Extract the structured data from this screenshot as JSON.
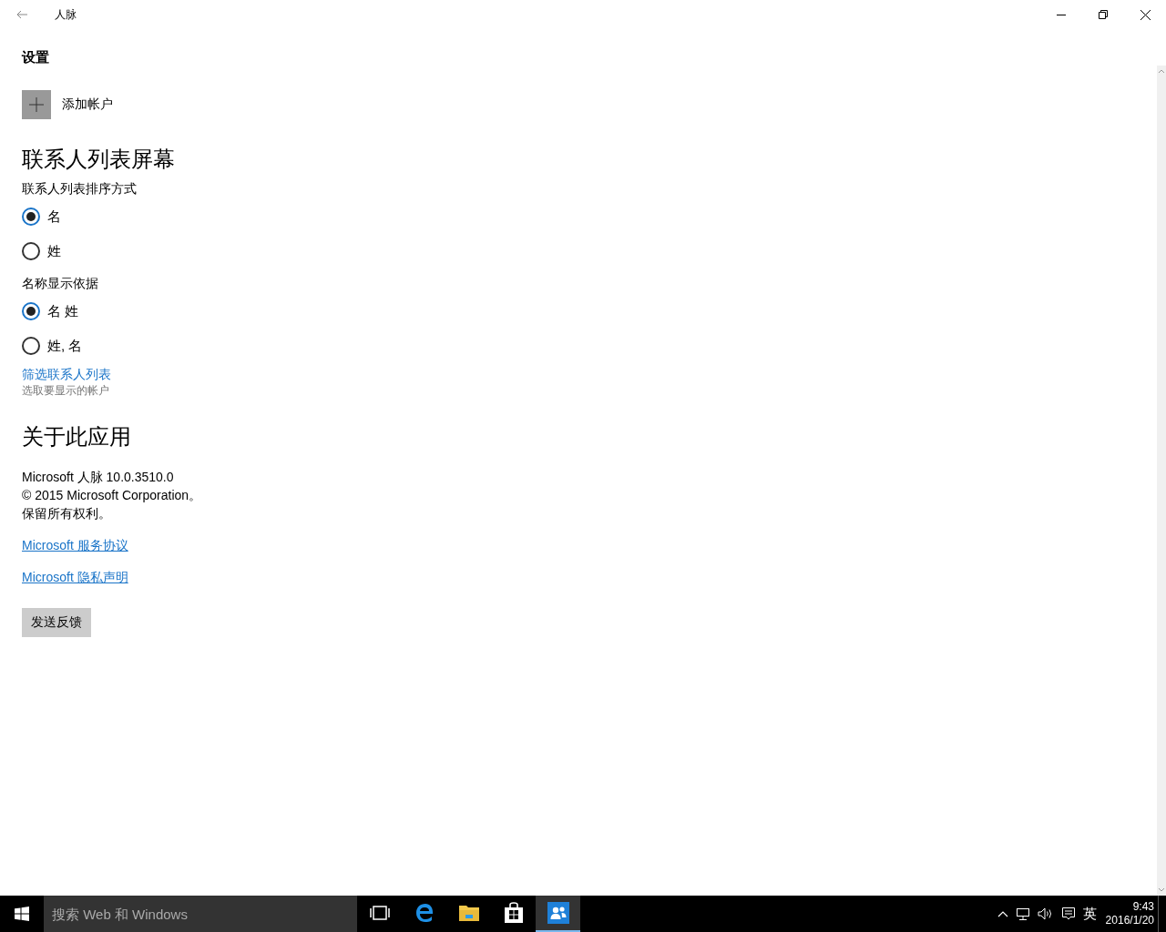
{
  "window": {
    "title": "人脉"
  },
  "page": {
    "heading": "设置"
  },
  "add_account": {
    "label": "添加帐户"
  },
  "contact_list_section": {
    "title": "联系人列表屏幕",
    "groups": [
      {
        "label": "联系人列表排序方式",
        "options": [
          {
            "label": "名",
            "selected": true
          },
          {
            "label": "姓",
            "selected": false
          }
        ]
      },
      {
        "label": "名称显示依据",
        "options": [
          {
            "label": "名 姓",
            "selected": true
          },
          {
            "label": "姓, 名",
            "selected": false
          }
        ]
      }
    ],
    "filter_link": {
      "label": "筛选联系人列表",
      "description": "选取要显示的帐户"
    }
  },
  "about": {
    "title": "关于此应用",
    "lines": [
      "Microsoft 人脉 10.0.3510.0",
      "© 2015 Microsoft Corporation。",
      "保留所有权利。"
    ],
    "links": [
      "Microsoft 服务协议",
      "Microsoft 隐私声明"
    ],
    "feedback_button": "发送反馈"
  },
  "taskbar": {
    "search": {
      "placeholder": "搜索 Web 和 Windows"
    },
    "apps": [
      {
        "kind": "task-view",
        "selected": false
      },
      {
        "kind": "browser",
        "selected": false
      },
      {
        "kind": "folder",
        "selected": false
      },
      {
        "kind": "store",
        "selected": false
      },
      {
        "kind": "people",
        "selected": true
      }
    ],
    "ime_label": "英",
    "clock": {
      "time": "9:43",
      "date": "2016/1/20"
    }
  }
}
